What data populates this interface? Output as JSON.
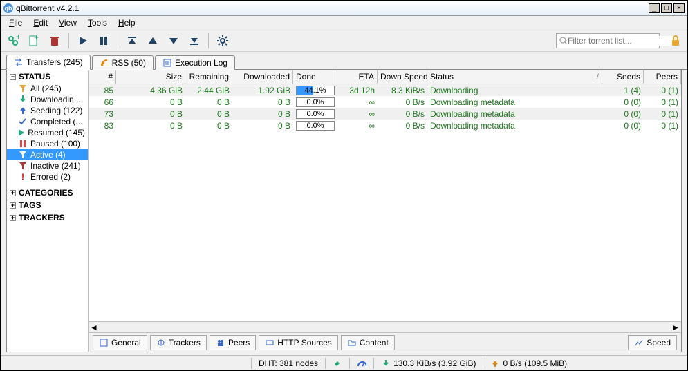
{
  "title": "qBittorrent v4.2.1",
  "menu": [
    "File",
    "Edit",
    "View",
    "Tools",
    "Help"
  ],
  "search_placeholder": "Filter torrent list...",
  "tabs": {
    "transfers": "Transfers (245)",
    "rss": "RSS (50)",
    "execlog": "Execution Log"
  },
  "sidebar": {
    "status_label": "STATUS",
    "items": [
      {
        "label": "All (245)"
      },
      {
        "label": "Downloadin..."
      },
      {
        "label": "Seeding (122)"
      },
      {
        "label": "Completed (..."
      },
      {
        "label": "Resumed (145)"
      },
      {
        "label": "Paused (100)"
      },
      {
        "label": "Active (4)"
      },
      {
        "label": "Inactive (241)"
      },
      {
        "label": "Errored (2)"
      }
    ],
    "categories_label": "CATEGORIES",
    "tags_label": "TAGS",
    "trackers_label": "TRACKERS"
  },
  "columns": {
    "num": "#",
    "size": "Size",
    "rem": "Remaining",
    "dl": "Downloaded",
    "done": "Done",
    "eta": "ETA",
    "dspd": "Down Speed",
    "status": "Status",
    "seeds": "Seeds",
    "peers": "Peers"
  },
  "rows": [
    {
      "num": "85",
      "size": "4.36 GiB",
      "rem": "2.44 GiB",
      "dl": "1.92 GiB",
      "done": "44.1%",
      "done_fill": 44,
      "eta": "3d 12h",
      "dspd": "8.3 KiB/s",
      "status": "Downloading",
      "seeds": "1 (4)",
      "peers": "0 (1)"
    },
    {
      "num": "66",
      "size": "0 B",
      "rem": "0 B",
      "dl": "0 B",
      "done": "0.0%",
      "done_fill": 0,
      "eta": "∞",
      "dspd": "0 B/s",
      "status": "Downloading metadata",
      "seeds": "0 (0)",
      "peers": "0 (1)"
    },
    {
      "num": "73",
      "size": "0 B",
      "rem": "0 B",
      "dl": "0 B",
      "done": "0.0%",
      "done_fill": 0,
      "eta": "∞",
      "dspd": "0 B/s",
      "status": "Downloading metadata",
      "seeds": "0 (0)",
      "peers": "0 (1)"
    },
    {
      "num": "83",
      "size": "0 B",
      "rem": "0 B",
      "dl": "0 B",
      "done": "0.0%",
      "done_fill": 0,
      "eta": "∞",
      "dspd": "0 B/s",
      "status": "Downloading metadata",
      "seeds": "0 (0)",
      "peers": "0 (1)"
    }
  ],
  "detail_tabs": {
    "general": "General",
    "trackers": "Trackers",
    "peers": "Peers",
    "http": "HTTP Sources",
    "content": "Content",
    "speed": "Speed"
  },
  "status": {
    "dht": "DHT: 381 nodes",
    "down": "130.3 KiB/s (3.92 GiB)",
    "up": "0 B/s (109.5 MiB)"
  }
}
